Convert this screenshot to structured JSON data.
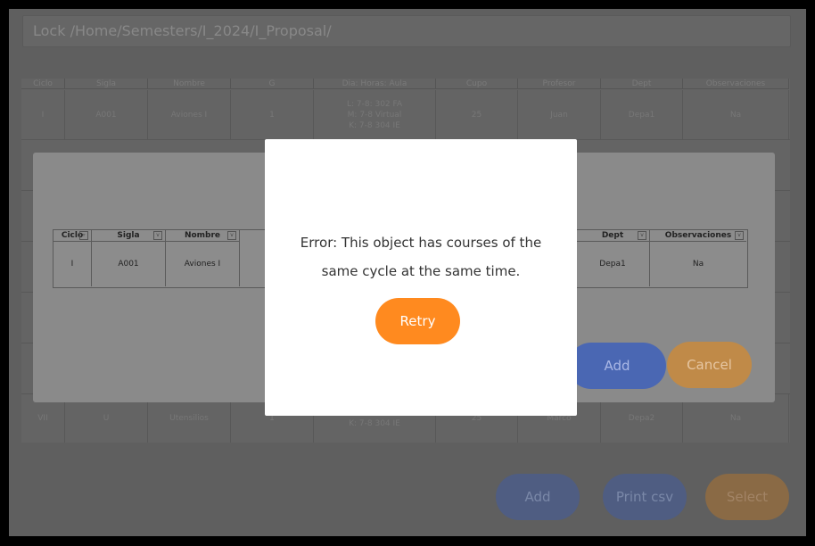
{
  "path": "Lock /Home/Semesters/I_2024/I_Proposal/",
  "table": {
    "columns": [
      "Ciclo",
      "Sigla",
      "Nombre",
      "G",
      "Dia: Horas: Aula",
      "Cupo",
      "Profesor",
      "Dept",
      "Observaciones"
    ],
    "rows": [
      [
        "I",
        "A001",
        "Aviones I",
        "1",
        "L: 7-8: 302 FA\nM: 7-8 Virtual\nK: 7-8 304 IE",
        "25",
        "Juan",
        "Depa1",
        "Na"
      ],
      [
        "VII",
        "U",
        "Utensilios",
        "1",
        "M: 7-8 Virtual\nK: 7-8 304 IE",
        "25",
        "Marco",
        "Depa2",
        "Na"
      ]
    ]
  },
  "bottom_buttons": {
    "add": "Add",
    "print": "Print csv",
    "select": "Select"
  },
  "dialog": {
    "columns": [
      "Ciclo",
      "Sigla",
      "Nombre",
      "Dept",
      "Observaciones"
    ],
    "row": [
      "I",
      "A001",
      "Aviones I",
      "Depa1",
      "Na"
    ],
    "add": "Add",
    "cancel": "Cancel"
  },
  "error": {
    "message_line1": "Error: This object has courses of the",
    "message_line2": "same cycle at the same time.",
    "retry": "Retry"
  }
}
